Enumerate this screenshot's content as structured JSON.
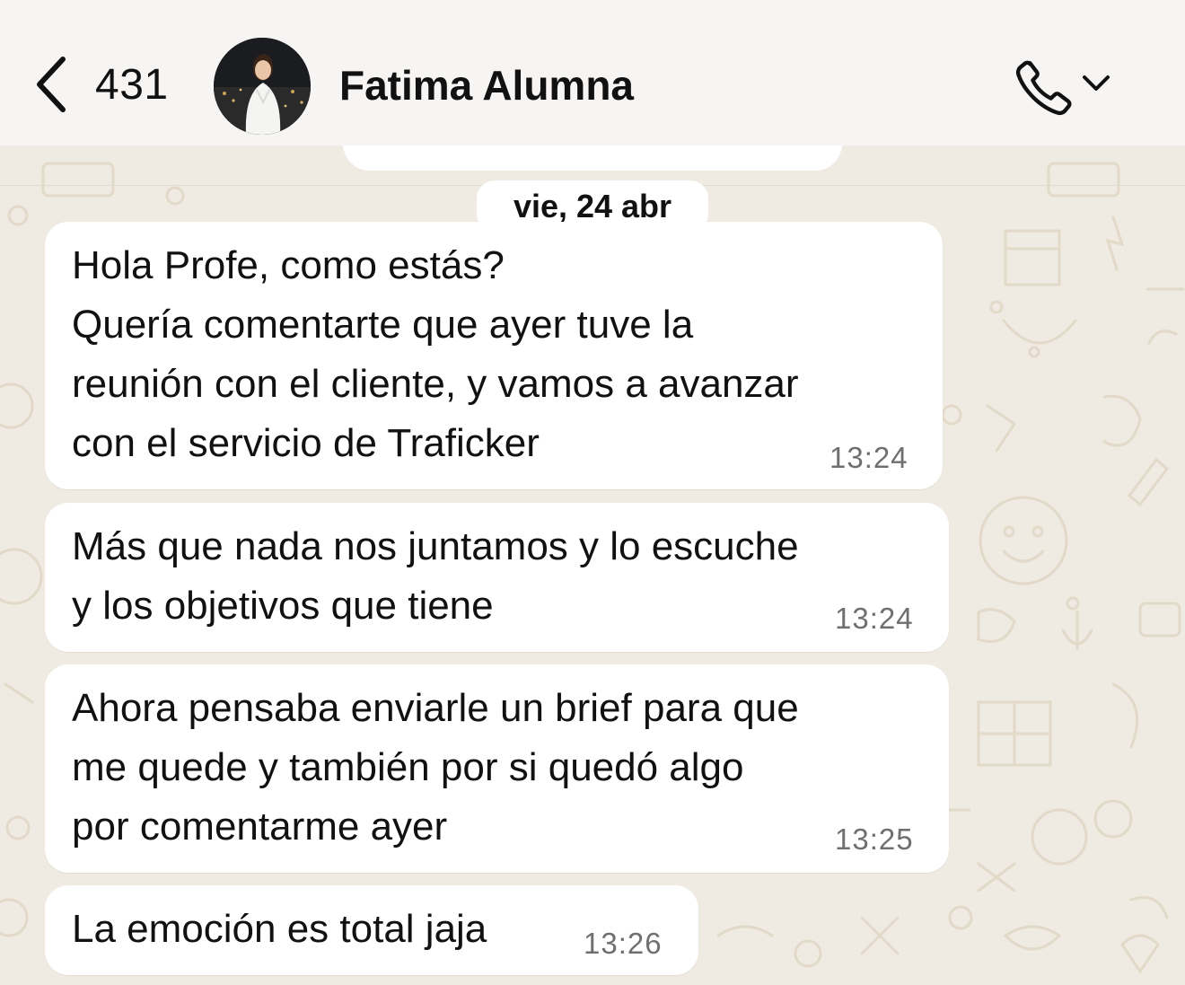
{
  "header": {
    "back_count": "431",
    "contact_name": "Fatima Alumna",
    "back_icon": "chevron-left-icon",
    "call_icon": "phone-icon",
    "call_menu_icon": "chevron-down-icon"
  },
  "date_label": "vie, 24 abr",
  "messages": [
    {
      "text": "Hola Profe, como estás?\nQuería comentarte que ayer tuve la\nreunión con el cliente, y vamos a avanzar\ncon el servicio de Traficker",
      "time": "13:24"
    },
    {
      "text": "Más que nada nos juntamos y lo escuche\ny los objetivos que tiene",
      "time": "13:24"
    },
    {
      "text": "Ahora pensaba enviarle un brief para que\nme quede y también por si quedó algo\npor comentarme ayer",
      "time": "13:25"
    },
    {
      "text": "La emoción es total jaja",
      "time": "13:26"
    }
  ],
  "colors": {
    "background": "#efeae2",
    "bubble": "#ffffff",
    "header": "#f6f5f3"
  }
}
